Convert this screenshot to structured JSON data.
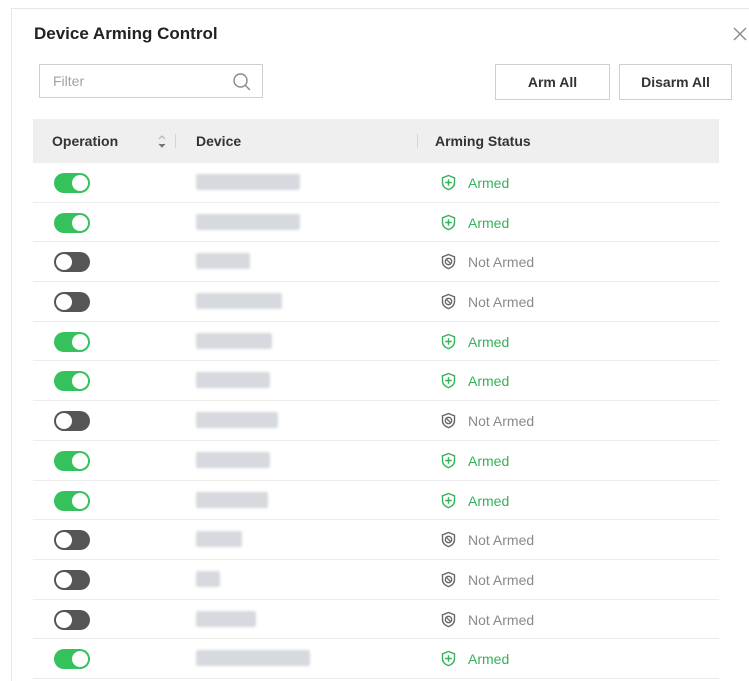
{
  "dialog": {
    "title": "Device Arming Control",
    "close_icon": "close-icon"
  },
  "toolbar": {
    "filter_placeholder": "Filter",
    "filter_value": "",
    "search_icon": "search-icon",
    "arm_all_label": "Arm All",
    "disarm_all_label": "Disarm All"
  },
  "table": {
    "columns": {
      "operation": "Operation",
      "device": "Device",
      "arming_status": "Arming Status"
    },
    "rows": [
      {
        "enabled": true,
        "status": "Armed"
      },
      {
        "enabled": true,
        "status": "Armed"
      },
      {
        "enabled": false,
        "status": "Not Armed"
      },
      {
        "enabled": false,
        "status": "Not Armed"
      },
      {
        "enabled": true,
        "status": "Armed"
      },
      {
        "enabled": true,
        "status": "Armed"
      },
      {
        "enabled": false,
        "status": "Not Armed"
      },
      {
        "enabled": true,
        "status": "Armed"
      },
      {
        "enabled": true,
        "status": "Armed"
      },
      {
        "enabled": false,
        "status": "Not Armed"
      },
      {
        "enabled": false,
        "status": "Not Armed"
      },
      {
        "enabled": false,
        "status": "Not Armed"
      },
      {
        "enabled": true,
        "status": "Armed"
      }
    ]
  },
  "colors": {
    "armed": "#35b15a",
    "toggle_on": "#35c15b",
    "toggle_off": "#555555",
    "not_armed": "#8a8a8a"
  }
}
